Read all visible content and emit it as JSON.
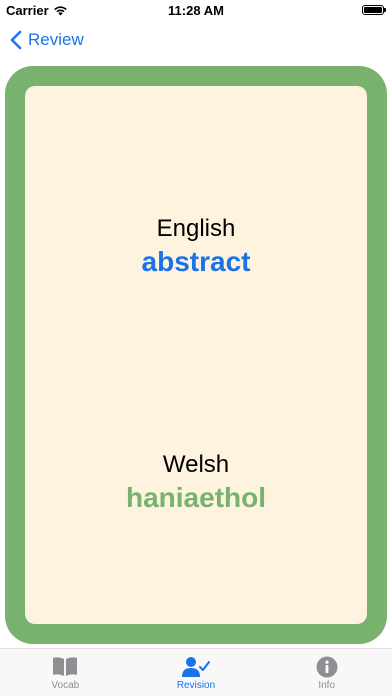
{
  "status_bar": {
    "carrier": "Carrier",
    "time": "11:28 AM"
  },
  "nav": {
    "back_label": "Review"
  },
  "card": {
    "source_language": "English",
    "source_word": "abstract",
    "target_language": "Welsh",
    "target_word": "haniaethol"
  },
  "tabs": [
    {
      "label": "Vocab",
      "icon": "book-icon",
      "active": false
    },
    {
      "label": "Revision",
      "icon": "person-check-icon",
      "active": true
    },
    {
      "label": "Info",
      "icon": "info-icon",
      "active": false
    }
  ],
  "colors": {
    "accent_blue": "#1a73e8",
    "card_green": "#79b16f",
    "card_background": "#fdf3df"
  }
}
